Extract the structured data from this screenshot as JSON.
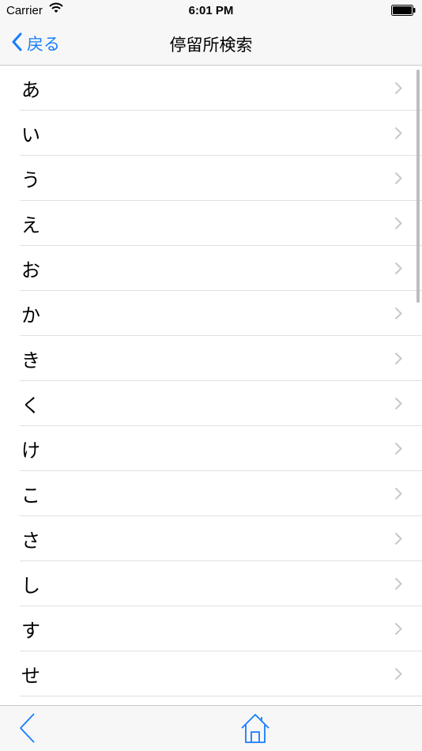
{
  "status_bar": {
    "carrier": "Carrier",
    "time": "6:01 PM",
    "wifi_icon": "wifi-icon",
    "battery_icon": "battery-icon"
  },
  "nav_bar": {
    "back_label": "戻る",
    "title": "停留所検索",
    "accent_color": "#157efb"
  },
  "list": {
    "rows": [
      {
        "label": "あ"
      },
      {
        "label": "い"
      },
      {
        "label": "う"
      },
      {
        "label": "え"
      },
      {
        "label": "お"
      },
      {
        "label": "か"
      },
      {
        "label": "き"
      },
      {
        "label": "く"
      },
      {
        "label": "け"
      },
      {
        "label": "こ"
      },
      {
        "label": "さ"
      },
      {
        "label": "し"
      },
      {
        "label": "す"
      },
      {
        "label": "せ"
      }
    ],
    "row_icon": "chevron-right-icon"
  },
  "toolbar": {
    "back_icon": "chevron-left-icon",
    "home_icon": "home-icon"
  }
}
